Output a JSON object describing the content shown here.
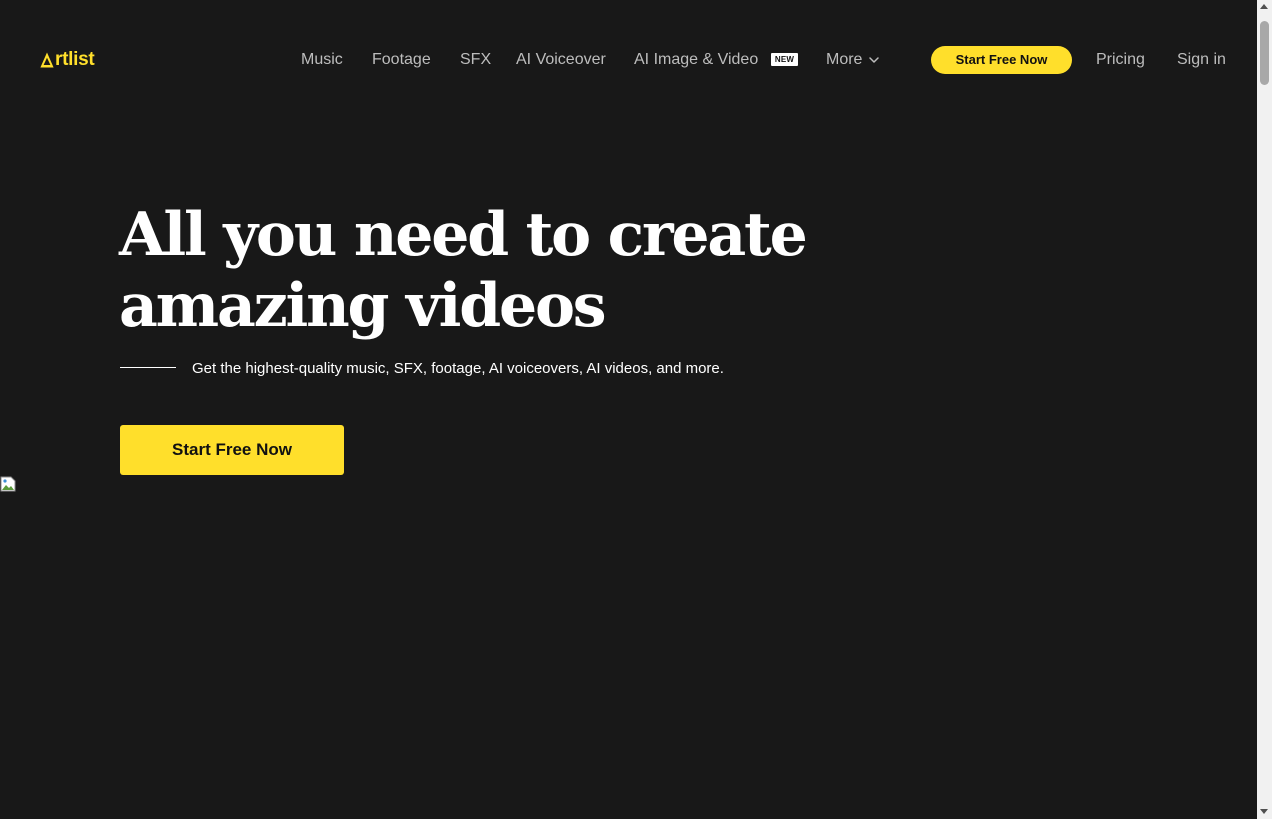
{
  "header": {
    "logo_text": "rtlist",
    "nav": {
      "music": "Music",
      "footage": "Footage",
      "sfx": "SFX",
      "ai_voiceover": "AI Voiceover",
      "ai_image_video": "AI Image & Video",
      "new_badge": "NEW",
      "more": "More"
    },
    "cta_label": "Start Free Now",
    "pricing": "Pricing",
    "sign_in": "Sign in"
  },
  "hero": {
    "title_line1": "All you need to create",
    "title_line2": "amazing videos",
    "subtitle": "Get the highest-quality music, SFX, footage, AI voiceovers, AI videos, and more.",
    "cta_label": "Start Free Now"
  },
  "colors": {
    "background": "#181818",
    "accent": "#ffdf2b",
    "nav_text": "#bdbdbd",
    "text": "#ffffff"
  },
  "icons": {
    "logo_mark": "triangle-a-logo-icon",
    "more_dropdown": "chevron-down-icon",
    "broken_image": "broken-image-icon"
  }
}
